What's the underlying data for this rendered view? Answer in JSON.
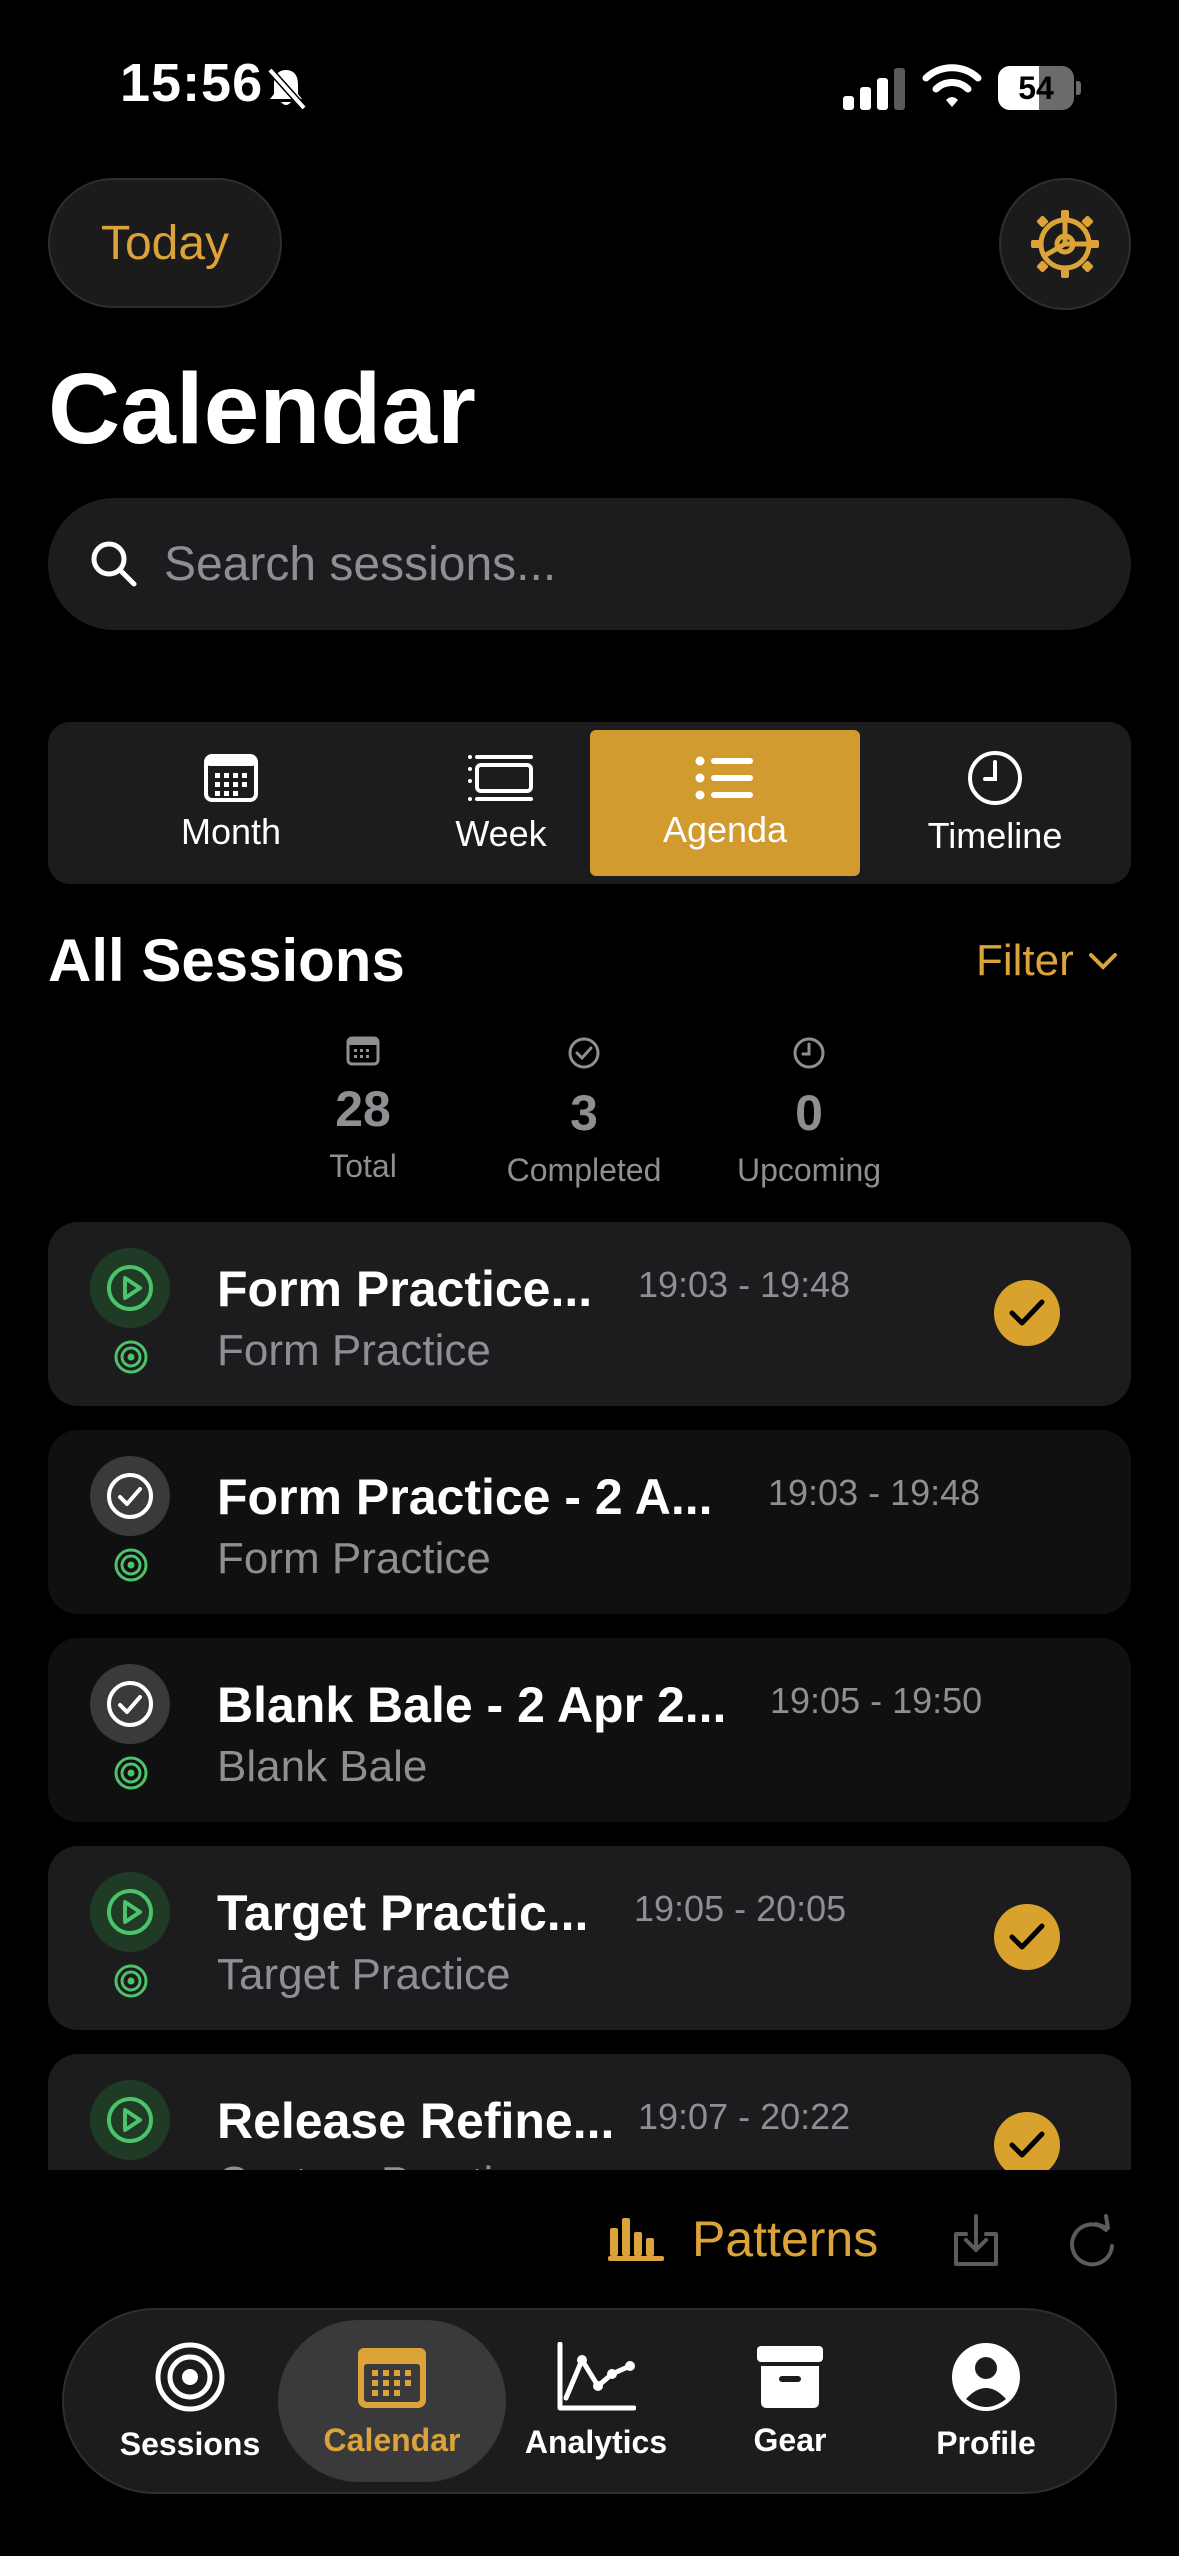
{
  "status_bar": {
    "time": "15:56",
    "battery": "54",
    "battery_level": 0.54
  },
  "header": {
    "today_label": "Today",
    "title": "Calendar"
  },
  "search": {
    "placeholder": "Search sessions..."
  },
  "view_modes": {
    "active": "Agenda",
    "items": [
      {
        "label": "Month",
        "icon": "calendar-grid-icon"
      },
      {
        "label": "Week",
        "icon": "week-icon"
      },
      {
        "label": "Agenda",
        "icon": "list-icon"
      },
      {
        "label": "Timeline",
        "icon": "clock-icon"
      }
    ]
  },
  "section": {
    "title": "All Sessions",
    "filter_label": "Filter"
  },
  "stats": [
    {
      "value": "28",
      "label": "Total",
      "icon": "calendar-icon"
    },
    {
      "value": "3",
      "label": "Completed",
      "icon": "check-circle-icon"
    },
    {
      "value": "0",
      "label": "Upcoming",
      "icon": "clock-icon"
    }
  ],
  "sessions": [
    {
      "title": "Form Practice...",
      "time": "19:03 - 19:48",
      "subtitle": "Form Practice",
      "status": "play",
      "checked": true
    },
    {
      "title": "Form Practice - 2 A...",
      "time": "19:03 - 19:48",
      "subtitle": "Form Practice",
      "status": "completed",
      "checked": false
    },
    {
      "title": "Blank Bale - 2 Apr 2...",
      "time": "19:05 - 19:50",
      "subtitle": "Blank Bale",
      "status": "completed",
      "checked": false
    },
    {
      "title": "Target Practic...",
      "time": "19:05 - 20:05",
      "subtitle": "Target Practice",
      "status": "play",
      "checked": true
    },
    {
      "title": "Release Refine...",
      "time": "19:07 - 20:22",
      "subtitle": "Custom Practice",
      "status": "play",
      "checked": true
    }
  ],
  "toolbar": {
    "patterns_label": "Patterns"
  },
  "tab_bar": {
    "active": "Calendar",
    "items": [
      {
        "label": "Sessions",
        "icon": "target-icon"
      },
      {
        "label": "Calendar",
        "icon": "calendar-icon"
      },
      {
        "label": "Analytics",
        "icon": "chart-line-icon"
      },
      {
        "label": "Gear",
        "icon": "archive-box-icon"
      },
      {
        "label": "Profile",
        "icon": "person-icon"
      }
    ]
  },
  "colors": {
    "accent": "#d19b30",
    "green": "#4cc26b",
    "card": "#1c1c1e",
    "background": "#000000"
  }
}
